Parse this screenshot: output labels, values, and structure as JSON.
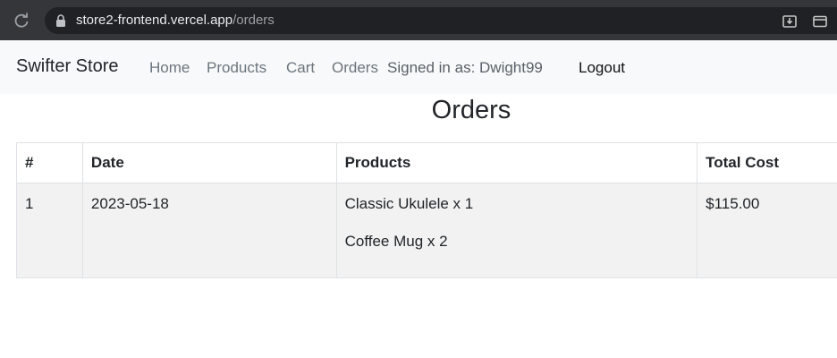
{
  "browser": {
    "url_host": "store2-frontend.vercel.app",
    "url_path": "/orders"
  },
  "navbar": {
    "brand": "Swifter Store",
    "links": [
      "Home",
      "Products",
      "Cart",
      "Orders"
    ],
    "signed_in": "Signed in as: Dwight99",
    "logout": "Logout"
  },
  "page": {
    "title": "Orders"
  },
  "table": {
    "headers": [
      "#",
      "Date",
      "Products",
      "Total Cost"
    ],
    "rows": [
      {
        "index": "1",
        "date": "2023-05-18",
        "products": [
          "Classic Ukulele x 1",
          "Coffee Mug x 2"
        ],
        "total": "$115.00"
      }
    ]
  },
  "colors": {
    "browser_bar": "#35363a",
    "url_box": "#202124",
    "navbar_bg": "#f8f9fa",
    "row_bg": "#f2f2f2"
  }
}
